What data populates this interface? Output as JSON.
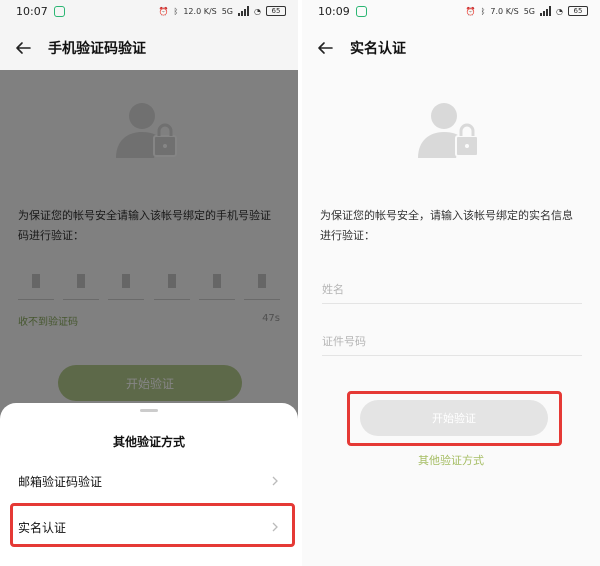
{
  "left_screen": {
    "status": {
      "time": "10:07",
      "net": "12.0 K/S",
      "network_type": "5G",
      "battery": "65"
    },
    "title": "手机验证码验证",
    "description": "为保证您的帐号安全请输入该帐号绑定的手机号验证码进行验证：",
    "code_digit_count": 6,
    "resend_label": "收不到验证码",
    "countdown": "47s",
    "start_button_label": "开始验证",
    "sheet": {
      "title": "其他验证方式",
      "items": [
        {
          "label": "邮箱验证码验证"
        },
        {
          "label": "实名认证"
        }
      ]
    }
  },
  "right_screen": {
    "status": {
      "time": "10:09",
      "net": "7.0 K/S",
      "network_type": "5G",
      "battery": "65"
    },
    "title": "实名认证",
    "description": "为保证您的帐号安全，请输入该帐号绑定的实名信息进行验证：",
    "fields": [
      {
        "placeholder": "姓名"
      },
      {
        "placeholder": "证件号码"
      }
    ],
    "start_button_label": "开始验证",
    "other_methods_link": "其他验证方式"
  },
  "icons": {
    "back": "arrow-left-icon",
    "avatar": "user-lock-icon",
    "chevron": "chevron-right-icon"
  },
  "colors": {
    "accent_green": "#87a85a",
    "button_green": "#b3c98c",
    "highlight_red": "#e53935",
    "disabled_button": "#e4e4e4"
  }
}
